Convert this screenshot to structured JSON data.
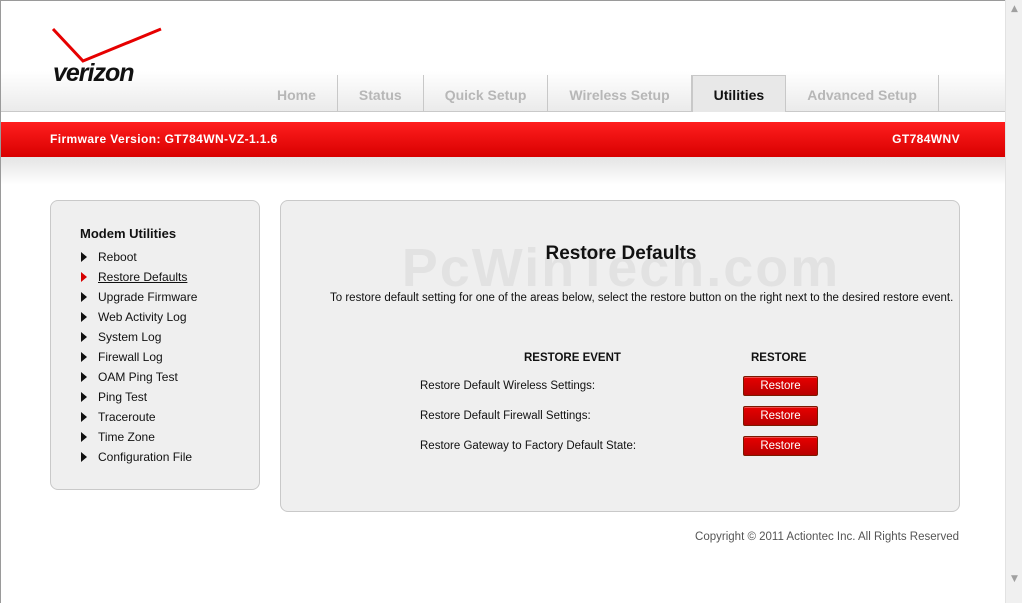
{
  "brand": {
    "logo_text": "verizon",
    "accent": "#e60000"
  },
  "tabs": [
    {
      "label": "Home",
      "active": false
    },
    {
      "label": "Status",
      "active": false
    },
    {
      "label": "Quick Setup",
      "active": false
    },
    {
      "label": "Wireless Setup",
      "active": false
    },
    {
      "label": "Utilities",
      "active": true
    },
    {
      "label": "Advanced Setup",
      "active": false
    }
  ],
  "banner": {
    "firmware": "Firmware Version: GT784WN-VZ-1.1.6",
    "model": "GT784WNV"
  },
  "sidebar": {
    "title": "Modem Utilities",
    "items": [
      {
        "label": "Reboot",
        "active": false
      },
      {
        "label": "Restore Defaults",
        "active": true
      },
      {
        "label": "Upgrade Firmware",
        "active": false
      },
      {
        "label": "Web Activity Log",
        "active": false
      },
      {
        "label": "System Log",
        "active": false
      },
      {
        "label": "Firewall Log",
        "active": false
      },
      {
        "label": "OAM Ping Test",
        "active": false
      },
      {
        "label": "Ping Test",
        "active": false
      },
      {
        "label": "Traceroute",
        "active": false
      },
      {
        "label": "Time Zone",
        "active": false
      },
      {
        "label": "Configuration File",
        "active": false
      }
    ]
  },
  "main": {
    "watermark": "PcWinTech.com",
    "title": "Restore Defaults",
    "description": "To restore default setting for one of the areas below, select the restore button on the right next to the desired restore event.",
    "columns": {
      "event": "RESTORE EVENT",
      "restore": "RESTORE"
    },
    "rows": [
      {
        "label": "Restore Default Wireless Settings:",
        "button": "Restore"
      },
      {
        "label": "Restore Default Firewall Settings:",
        "button": "Restore"
      },
      {
        "label": "Restore Gateway to Factory Default State:",
        "button": "Restore"
      }
    ]
  },
  "footer": {
    "copyright": "Copyright © 2011 Actiontec Inc. All Rights Reserved"
  }
}
